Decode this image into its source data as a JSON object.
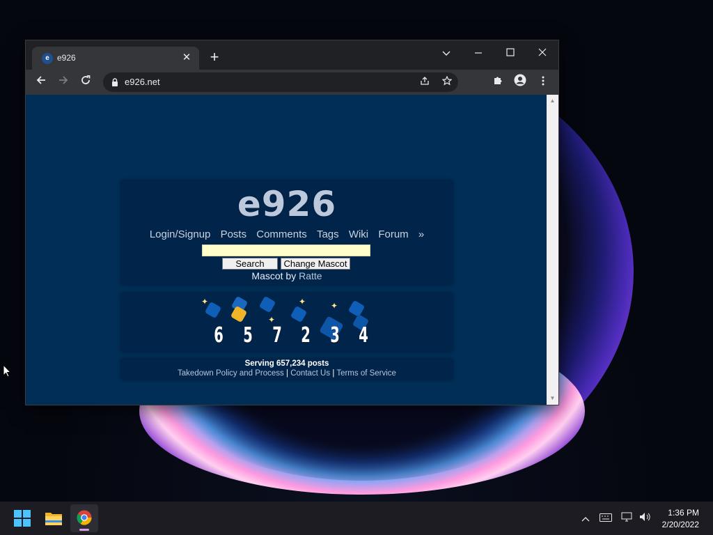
{
  "browser": {
    "tab_title": "e926",
    "tab_favicon": "e",
    "tab_close": "✕",
    "new_tab": "+",
    "url": "e926.net",
    "icons": {
      "back": "back-arrow-icon",
      "forward": "forward-arrow-icon",
      "reload": "reload-icon",
      "lock": "lock-icon",
      "share": "share-icon",
      "bookmark": "star-icon",
      "extensions": "puzzle-icon",
      "profile": "profile-icon",
      "menu": "kebab-menu-icon"
    }
  },
  "page": {
    "site_title": "e926",
    "nav": [
      "Login/Signup",
      "Posts",
      "Comments",
      "Tags",
      "Wiki",
      "Forum",
      "»"
    ],
    "search_button": "Search",
    "change_mascot_button": "Change Mascot",
    "mascot_prefix": "Mascot by",
    "mascot_artist": "Ratte",
    "counter_digits": [
      "6",
      "5",
      "7",
      "2",
      "3",
      "4"
    ],
    "serving_text": "Serving 657,234 posts",
    "footer_links": [
      "Takedown Policy and Process",
      "Contact Us",
      "Terms of Service"
    ],
    "footer_separator": "|"
  },
  "taskbar": {
    "apps": [
      "start-icon",
      "file-explorer-icon",
      "chrome-icon"
    ],
    "time": "1:36 PM",
    "date": "2/20/2022"
  },
  "colors": {
    "page_bg": "#012e56",
    "panel_bg": "#01244a",
    "search_bg": "#ffffcc",
    "title_color": "#bcc9dc",
    "link_color": "#b4c7dc"
  }
}
